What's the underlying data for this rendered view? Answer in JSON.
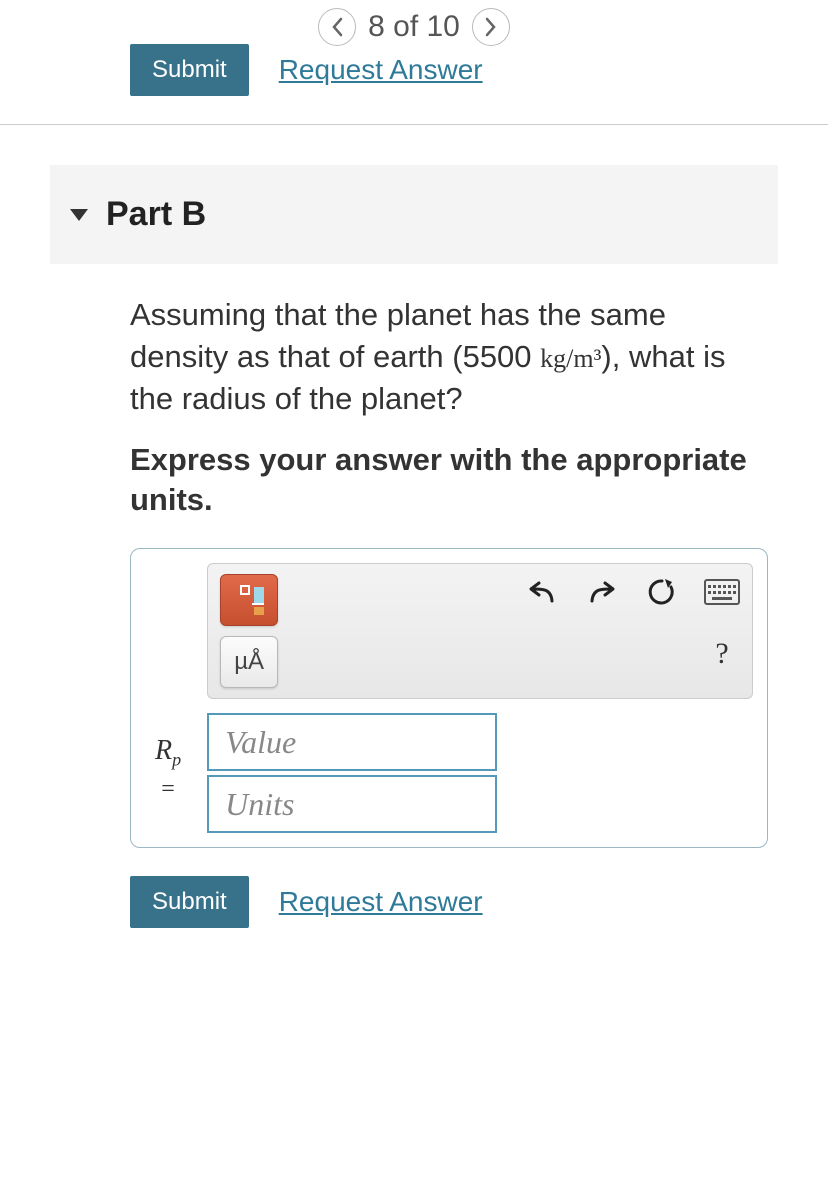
{
  "pager": {
    "position": "8 of 10"
  },
  "actions": {
    "submit": "Submit",
    "request": "Request Answer"
  },
  "part": {
    "label": "Part B",
    "question_prefix": "Assuming that the planet has the same density as that of earth (",
    "density_value": "5500",
    "density_unit": "kg/m³",
    "question_suffix": "), what is the radius of the planet?",
    "instruction": "Express your answer with the appropriate units."
  },
  "answer": {
    "variable": "R",
    "subscript": "p",
    "eq": "=",
    "value_placeholder": "Value",
    "units_placeholder": "Units",
    "mu_a": "µÅ",
    "help": "?"
  }
}
